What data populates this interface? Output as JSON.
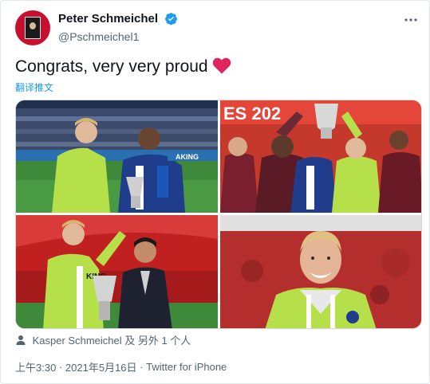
{
  "user": {
    "display_name": "Peter Schmeichel",
    "handle": "@Pschmeichel1"
  },
  "tweet": {
    "text": "Congrats, very very proud",
    "translate_label": "翻译推文"
  },
  "media": {
    "photo1_banner": "AKING",
    "photo2_banner": "ES 202",
    "photo3_banner": "KING"
  },
  "tags": {
    "label": "Kasper Schmeichel 及 另外 1 个人"
  },
  "meta": {
    "time": "上午3:30",
    "separator1": "·",
    "date": "2021年5月16日",
    "separator2": "·",
    "source": "Twitter for iPhone"
  },
  "colors": {
    "accent": "#1d9bf0",
    "heart": "#e0245e",
    "keeper_green": "#b6e04a",
    "leicester_blue": "#1f3d8a",
    "red_stand": "#d0021b"
  }
}
